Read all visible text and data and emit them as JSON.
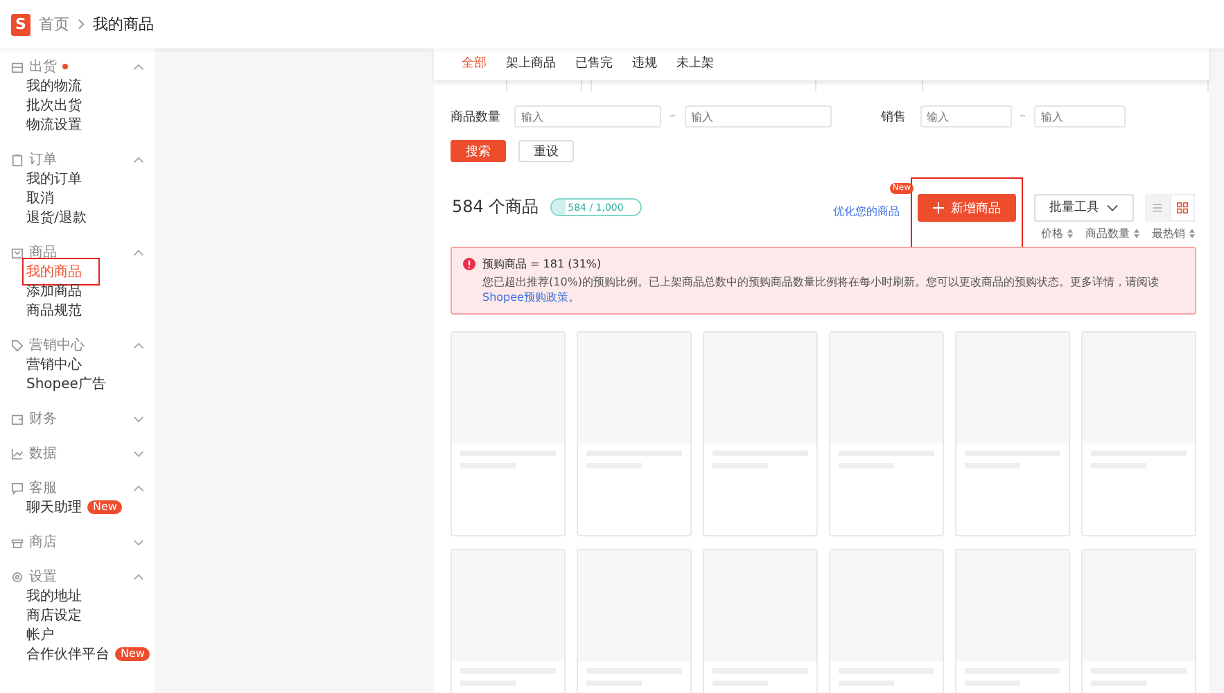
{
  "header": {
    "logo": "S",
    "breadcrumb": [
      {
        "label": "首页"
      },
      {
        "label": "我的商品"
      }
    ]
  },
  "sidebar": {
    "groups": [
      {
        "label": "出货",
        "dot": true,
        "expanded": true,
        "items": [
          {
            "label": "我的物流",
            "selected": false
          },
          {
            "label": "批次出货",
            "selected": false
          },
          {
            "label": "物流设置",
            "selected": false
          }
        ]
      },
      {
        "label": "订单",
        "dot": false,
        "expanded": true,
        "items": [
          {
            "label": "我的订单",
            "selected": false
          },
          {
            "label": "取消",
            "selected": false
          },
          {
            "label": "退货/退款",
            "selected": false
          }
        ]
      },
      {
        "label": "商品",
        "dot": false,
        "expanded": true,
        "items": [
          {
            "label": "我的商品",
            "selected": true,
            "highlighted": true
          },
          {
            "label": "添加商品",
            "selected": false
          },
          {
            "label": "商品规范",
            "selected": false
          }
        ]
      },
      {
        "label": "营销中心",
        "dot": false,
        "expanded": true,
        "items": [
          {
            "label": "营销中心",
            "selected": false
          },
          {
            "label": "Shopee广告",
            "selected": false
          }
        ]
      },
      {
        "label": "财务",
        "dot": false,
        "expanded": false
      },
      {
        "label": "数据",
        "dot": false,
        "expanded": false
      },
      {
        "label": "客服",
        "dot": false,
        "expanded": true,
        "items": [
          {
            "label": "聊天助理",
            "selected": false,
            "badge": "New"
          }
        ]
      },
      {
        "label": "商店",
        "dot": false,
        "expanded": false
      },
      {
        "label": "设置",
        "dot": false,
        "expanded": true,
        "items": [
          {
            "label": "我的地址",
            "selected": false
          },
          {
            "label": "商店设定",
            "selected": false
          },
          {
            "label": "帐户",
            "selected": false
          },
          {
            "label": "合作伙伴平台",
            "selected": false,
            "badge": "New"
          }
        ]
      }
    ]
  },
  "tabs": [
    {
      "label": "全部",
      "selected": true
    },
    {
      "label": "架上商品",
      "selected": false
    },
    {
      "label": "已售完",
      "selected": false
    },
    {
      "label": "违规",
      "selected": false
    },
    {
      "label": "未上架",
      "selected": false
    }
  ],
  "filters": [
    {
      "label": "商品数量",
      "from_placeholder": "输入",
      "to_placeholder": "输入",
      "separator": "–"
    },
    {
      "label": "销售",
      "from_placeholder": "输入",
      "to_placeholder": "输入",
      "separator": "–"
    }
  ],
  "form_buttons": {
    "search": "搜索",
    "reset": "重设"
  },
  "summary": {
    "count": "584 个商品",
    "quota": {
      "label": "584 / 1,000",
      "level": 0.16
    }
  },
  "actions": {
    "optimize_link": "优化您的商品",
    "optimize_badge": "New",
    "add_button": "新增商品",
    "add_highlighted": true,
    "bulk_tools": "批量工具",
    "views": [
      {
        "kind": "list",
        "selected": false
      },
      {
        "kind": "grid",
        "selected": true
      }
    ]
  },
  "sort": [
    {
      "label": "价格"
    },
    {
      "label": "商品数量"
    },
    {
      "label": "最热销"
    }
  ],
  "alert": {
    "title": "预购商品 = 181 (31%)",
    "text": "您已超出推荐(10%)的预购比例。已上架商品总数中的预购商品数量比例将在每小时刷新。您可以更改商品的预购状态。更多详情，请阅读",
    "link": "Shopee预购政策",
    "end": "。"
  }
}
